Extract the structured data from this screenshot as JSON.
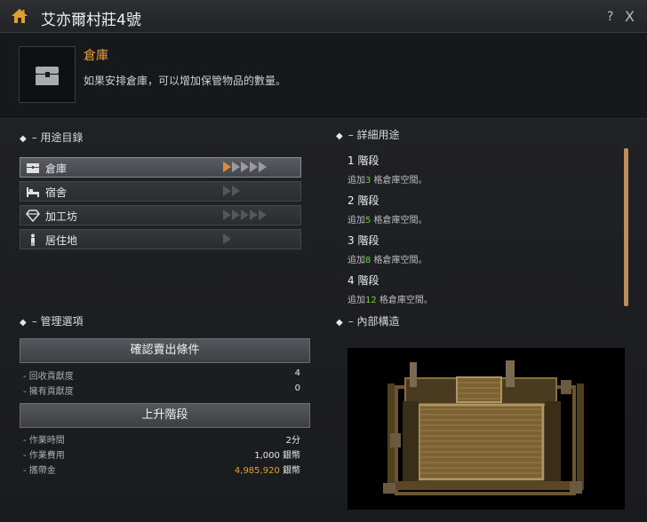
{
  "window": {
    "title": "艾亦爾村莊4號",
    "help_label": "?",
    "close_label": "X"
  },
  "header": {
    "name": "倉庫",
    "description": "如果安排倉庫，可以增加保管物品的數量。"
  },
  "usage": {
    "title": "用途目錄",
    "items": [
      {
        "label": "倉庫",
        "icon": "chest-icon",
        "stages_total": 5,
        "selected": true
      },
      {
        "label": "宿舍",
        "icon": "bed-icon",
        "stages_total": 2,
        "selected": false
      },
      {
        "label": "加工坊",
        "icon": "gem-icon",
        "stages_total": 5,
        "selected": false
      },
      {
        "label": "居住地",
        "icon": "person-icon",
        "stages_total": 1,
        "selected": false
      }
    ]
  },
  "details": {
    "title": "詳細用途",
    "stages": [
      {
        "title": "1 階段",
        "prefix": "追加",
        "num": "3",
        "suffix": " 格倉庫空間。"
      },
      {
        "title": "2 階段",
        "prefix": "追加",
        "num": "5",
        "suffix": " 格倉庫空間。"
      },
      {
        "title": "3 階段",
        "prefix": "追加",
        "num": "8",
        "suffix": " 格倉庫空間。"
      },
      {
        "title": "4 階段",
        "prefix": "追加",
        "num": "12",
        "suffix": " 格倉庫空間。"
      }
    ]
  },
  "management": {
    "title": "管理選項",
    "sell_button": "確認賣出條件",
    "recover_label": "回收貢獻度",
    "recover_value": "4",
    "own_label": "擁有貢獻度",
    "own_value": "0",
    "upgrade_button": "上升階段",
    "time_label": "作業時間",
    "time_value": "2分",
    "cost_label": "作業費用",
    "cost_value": "1,000 銀幣",
    "money_label": "攜帶金",
    "money_amount": "4,985,920",
    "money_unit": " 銀幣"
  },
  "interior": {
    "title": "內部構造"
  },
  "colors": {
    "accent": "#e08a38",
    "stage_num": "#6fcf3a",
    "gold": "#e0a030"
  }
}
